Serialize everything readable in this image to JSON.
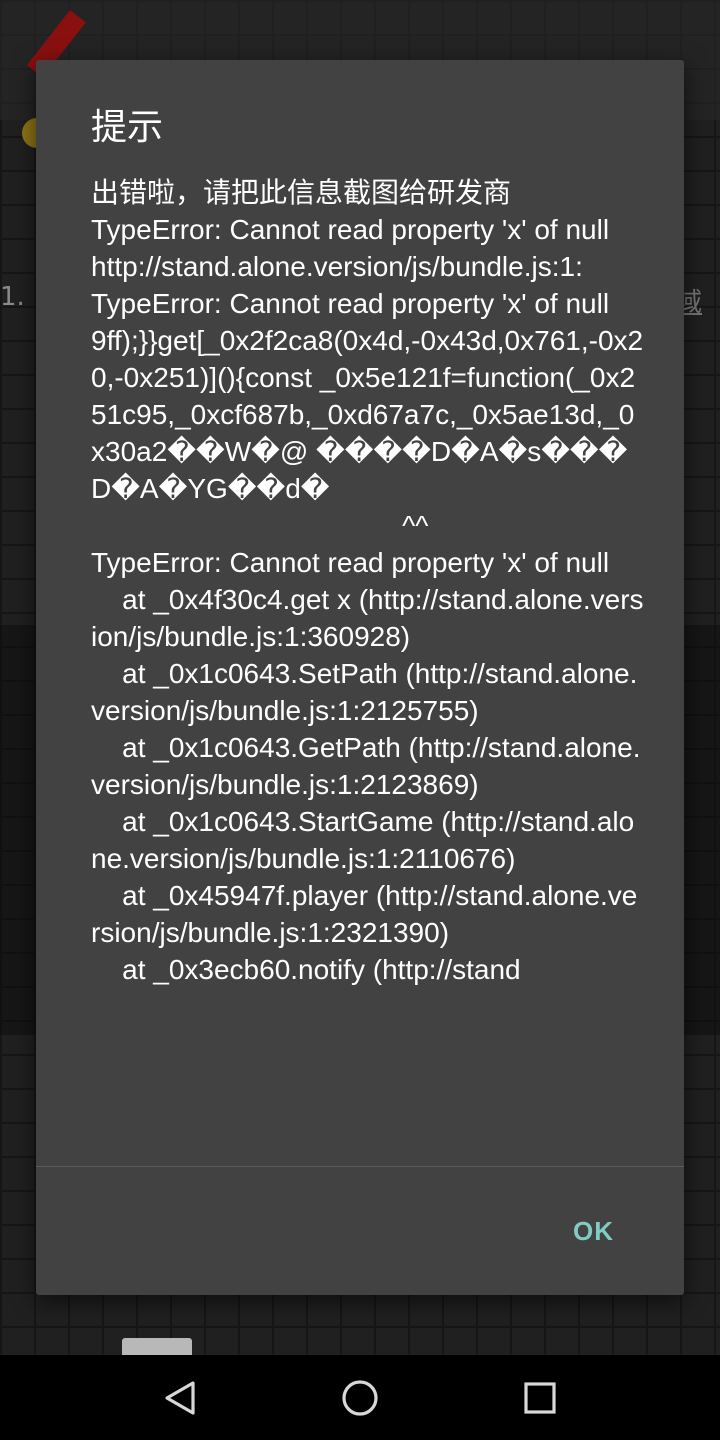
{
  "dialog": {
    "title": "提示",
    "message": "出错啦，请把此信息截图给研发商\nTypeError: Cannot read property 'x' of null\nhttp://stand.alone.version/js/bundle.js:1:\nTypeError: Cannot read property 'x' of null\n9ff);}}get[_0x2f2ca8(0x4d,-0x43d,0x761,-0x20,-0x251)](){const _0x5e121f=function(_0x251c95,_0xcf687b,_0xd67a7c,_0x5ae13d,_0x30a2��W�@ ����D�A�s���D�A�YG��d�\n                                        ^^\nTypeError: Cannot read property 'x' of null\n    at _0x4f30c4.get x (http://stand.alone.version/js/bundle.js:1:360928)\n    at _0x1c0643.SetPath (http://stand.alone.version/js/bundle.js:1:2125755)\n    at _0x1c0643.GetPath (http://stand.alone.version/js/bundle.js:1:2123869)\n    at _0x1c0643.StartGame (http://stand.alone.version/js/bundle.js:1:2110676)\n    at _0x45947f.player (http://stand.alone.version/js/bundle.js:1:2321390)\n    at _0x3ecb60.notify (http://stand",
    "ok_label": "OK"
  },
  "background": {
    "side_number": "1.",
    "side_text": "域"
  },
  "colors": {
    "dialog_bg": "#424242",
    "accent": "#80cbc4",
    "text": "#ffffff"
  },
  "nav": {
    "back_icon": "back-triangle-icon",
    "home_icon": "home-circle-icon",
    "recents_icon": "recents-square-icon"
  }
}
